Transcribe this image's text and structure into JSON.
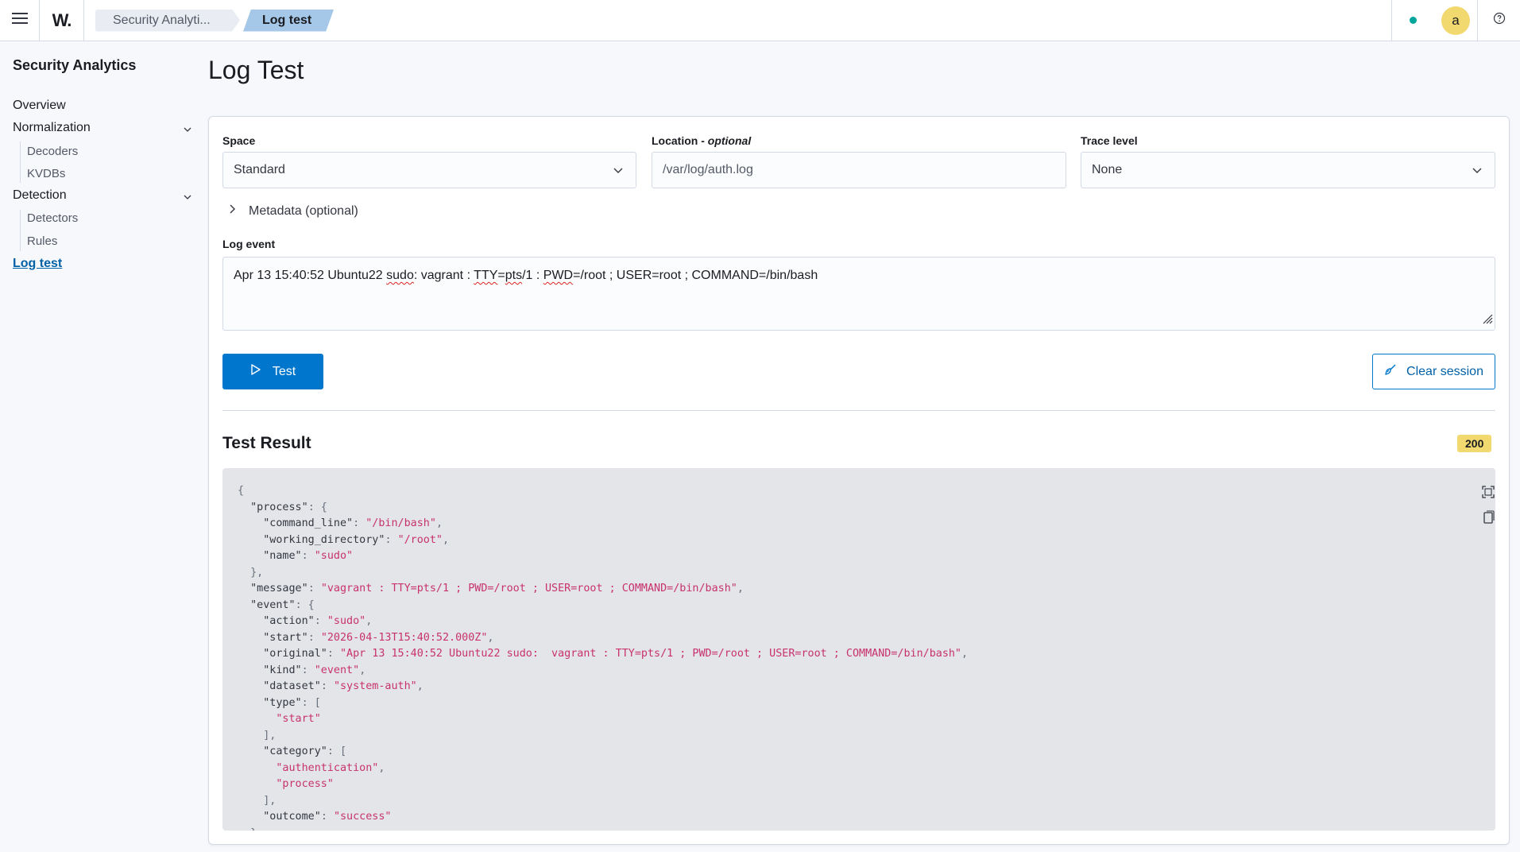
{
  "header": {
    "logo": "W.",
    "breadcrumbs": [
      "Security Analyti...",
      "Log test"
    ],
    "avatar_initial": "a"
  },
  "sidebar": {
    "title": "Security Analytics",
    "items": {
      "overview": "Overview",
      "normalization": "Normalization",
      "decoders": "Decoders",
      "kvdbs": "KVDBs",
      "detection": "Detection",
      "detectors": "Detectors",
      "rules": "Rules",
      "log_test": "Log test"
    }
  },
  "main": {
    "title": "Log Test",
    "space": {
      "label": "Space",
      "value": "Standard"
    },
    "location": {
      "label": "Location - ",
      "label_optional": "optional",
      "value": "/var/log/auth.log"
    },
    "trace": {
      "label": "Trace level",
      "value": "None"
    },
    "metadata_label": "Metadata (optional)",
    "log_event": {
      "label": "Log event",
      "parts": [
        "Apr 13 15:40:52 Ubuntu22 ",
        "sudo",
        ":  vagrant : ",
        "TTY",
        "=",
        "pts",
        "/1 : ",
        "PWD",
        "=/root ; USER=root ; COMMAND=/bin/bash"
      ]
    },
    "test_button": "Test",
    "clear_button": "Clear session",
    "result": {
      "title": "Test Result",
      "status_code": "200"
    }
  },
  "code_lines": [
    [
      [
        "p",
        "{"
      ]
    ],
    [
      [
        "p",
        "  "
      ],
      [
        "k",
        "\"process\""
      ],
      [
        "p",
        ": {"
      ]
    ],
    [
      [
        "p",
        "    "
      ],
      [
        "k",
        "\"command_line\""
      ],
      [
        "p",
        ": "
      ],
      [
        "s",
        "\"/bin/bash\""
      ],
      [
        "p",
        ","
      ]
    ],
    [
      [
        "p",
        "    "
      ],
      [
        "k",
        "\"working_directory\""
      ],
      [
        "p",
        ": "
      ],
      [
        "s",
        "\"/root\""
      ],
      [
        "p",
        ","
      ]
    ],
    [
      [
        "p",
        "    "
      ],
      [
        "k",
        "\"name\""
      ],
      [
        "p",
        ": "
      ],
      [
        "s",
        "\"sudo\""
      ]
    ],
    [
      [
        "p",
        "  },"
      ]
    ],
    [
      [
        "p",
        "  "
      ],
      [
        "k",
        "\"message\""
      ],
      [
        "p",
        ": "
      ],
      [
        "s",
        "\"vagrant : TTY=pts/1 ; PWD=/root ; USER=root ; COMMAND=/bin/bash\""
      ],
      [
        "p",
        ","
      ]
    ],
    [
      [
        "p",
        "  "
      ],
      [
        "k",
        "\"event\""
      ],
      [
        "p",
        ": {"
      ]
    ],
    [
      [
        "p",
        "    "
      ],
      [
        "k",
        "\"action\""
      ],
      [
        "p",
        ": "
      ],
      [
        "s",
        "\"sudo\""
      ],
      [
        "p",
        ","
      ]
    ],
    [
      [
        "p",
        "    "
      ],
      [
        "k",
        "\"start\""
      ],
      [
        "p",
        ": "
      ],
      [
        "s",
        "\"2026-04-13T15:40:52.000Z\""
      ],
      [
        "p",
        ","
      ]
    ],
    [
      [
        "p",
        "    "
      ],
      [
        "k",
        "\"original\""
      ],
      [
        "p",
        ": "
      ],
      [
        "s",
        "\"Apr 13 15:40:52 Ubuntu22 sudo:  vagrant : TTY=pts/1 ; PWD=/root ; USER=root ; COMMAND=/bin/bash\""
      ],
      [
        "p",
        ","
      ]
    ],
    [
      [
        "p",
        "    "
      ],
      [
        "k",
        "\"kind\""
      ],
      [
        "p",
        ": "
      ],
      [
        "s",
        "\"event\""
      ],
      [
        "p",
        ","
      ]
    ],
    [
      [
        "p",
        "    "
      ],
      [
        "k",
        "\"dataset\""
      ],
      [
        "p",
        ": "
      ],
      [
        "s",
        "\"system-auth\""
      ],
      [
        "p",
        ","
      ]
    ],
    [
      [
        "p",
        "    "
      ],
      [
        "k",
        "\"type\""
      ],
      [
        "p",
        ": ["
      ]
    ],
    [
      [
        "p",
        "      "
      ],
      [
        "s",
        "\"start\""
      ]
    ],
    [
      [
        "p",
        "    ],"
      ]
    ],
    [
      [
        "p",
        "    "
      ],
      [
        "k",
        "\"category\""
      ],
      [
        "p",
        ": ["
      ]
    ],
    [
      [
        "p",
        "      "
      ],
      [
        "s",
        "\"authentication\""
      ],
      [
        "p",
        ","
      ]
    ],
    [
      [
        "p",
        "      "
      ],
      [
        "s",
        "\"process\""
      ]
    ],
    [
      [
        "p",
        "    ],"
      ]
    ],
    [
      [
        "p",
        "    "
      ],
      [
        "k",
        "\"outcome\""
      ],
      [
        "p",
        ": "
      ],
      [
        "s",
        "\"success\""
      ]
    ],
    [
      [
        "p",
        "  },"
      ]
    ]
  ],
  "colors": {
    "primary": "#0077cc",
    "badge": "#f1d86f",
    "string": "#c8326e",
    "status_dot": "#00a69b"
  }
}
